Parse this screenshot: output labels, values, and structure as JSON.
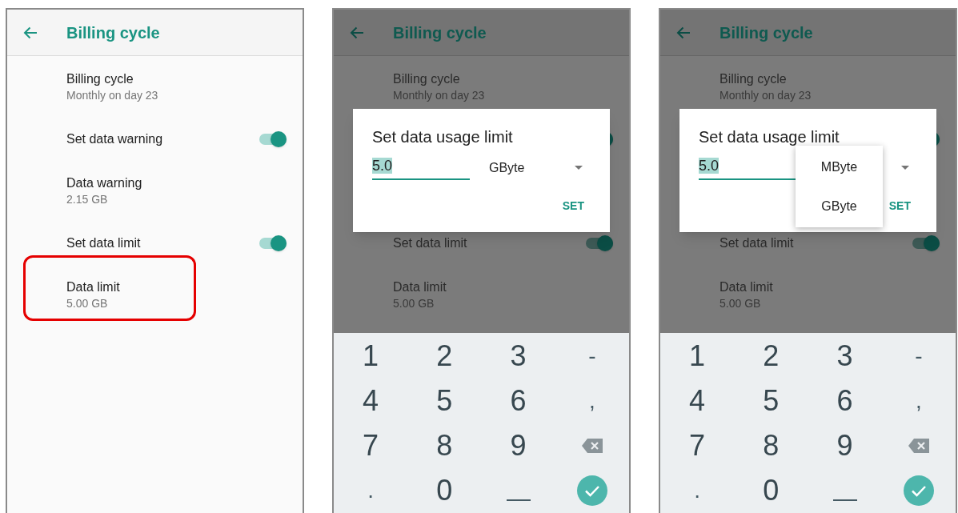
{
  "screens": [
    {
      "header": {
        "title": "Billing cycle"
      },
      "items": [
        {
          "kind": "text",
          "title": "Billing cycle",
          "summary": "Monthly on day 23",
          "highlighted": false
        },
        {
          "kind": "toggle",
          "title": "Set data warning",
          "on": true,
          "highlighted": false
        },
        {
          "kind": "text",
          "title": "Data warning",
          "summary": "2.15 GB",
          "highlighted": false
        },
        {
          "kind": "toggle",
          "title": "Set data limit",
          "on": true,
          "highlighted": false
        },
        {
          "kind": "text",
          "title": "Data limit",
          "summary": "5.00 GB",
          "highlighted": true
        }
      ]
    },
    {
      "header": {
        "title": "Billing cycle"
      },
      "items": [
        {
          "kind": "text",
          "title": "Billing cycle",
          "summary": "Monthly on day 23",
          "highlighted": false
        },
        {
          "kind": "toggle",
          "on": true
        },
        {
          "kind": "blank"
        },
        {
          "kind": "toggle",
          "title": "Set data limit",
          "on": true,
          "highlighted": false
        },
        {
          "kind": "text",
          "title": "Data limit",
          "summary": "5.00 GB",
          "highlighted": false
        }
      ],
      "dialog": {
        "title": "Set data usage limit",
        "value": "5.0",
        "unit": "GByte",
        "button": "SET"
      },
      "keyboard": [
        {
          "kind": "char",
          "label": "1"
        },
        {
          "kind": "char",
          "label": "2"
        },
        {
          "kind": "char",
          "label": "3"
        },
        {
          "kind": "symbol",
          "label": "-"
        },
        {
          "kind": "char",
          "label": "4"
        },
        {
          "kind": "char",
          "label": "5"
        },
        {
          "kind": "char",
          "label": "6"
        },
        {
          "kind": "symbol",
          "label": ","
        },
        {
          "kind": "char",
          "label": "7"
        },
        {
          "kind": "char",
          "label": "8"
        },
        {
          "kind": "char",
          "label": "9"
        },
        {
          "kind": "backspace"
        },
        {
          "kind": "symbol",
          "label": "."
        },
        {
          "kind": "char",
          "label": "0"
        },
        {
          "kind": "space"
        },
        {
          "kind": "done"
        }
      ]
    },
    {
      "header": {
        "title": "Billing cycle"
      },
      "items": [
        {
          "kind": "text",
          "title": "Billing cycle",
          "summary": "Monthly on day 23",
          "highlighted": false
        },
        {
          "kind": "toggle",
          "on": true
        },
        {
          "kind": "blank"
        },
        {
          "kind": "toggle",
          "title": "Set data limit",
          "on": true,
          "highlighted": false
        },
        {
          "kind": "text",
          "title": "Data limit",
          "summary": "5.00 GB",
          "highlighted": false
        }
      ],
      "dialog": {
        "title": "Set data usage limit",
        "value": "5.0",
        "menu": [
          "MByte",
          "GByte"
        ],
        "button": "SET"
      },
      "keyboard": [
        {
          "kind": "char",
          "label": "1"
        },
        {
          "kind": "char",
          "label": "2"
        },
        {
          "kind": "char",
          "label": "3"
        },
        {
          "kind": "symbol",
          "label": "-"
        },
        {
          "kind": "char",
          "label": "4"
        },
        {
          "kind": "char",
          "label": "5"
        },
        {
          "kind": "char",
          "label": "6"
        },
        {
          "kind": "symbol",
          "label": ","
        },
        {
          "kind": "char",
          "label": "7"
        },
        {
          "kind": "char",
          "label": "8"
        },
        {
          "kind": "char",
          "label": "9"
        },
        {
          "kind": "backspace"
        },
        {
          "kind": "symbol",
          "label": "."
        },
        {
          "kind": "char",
          "label": "0"
        },
        {
          "kind": "space"
        },
        {
          "kind": "done"
        }
      ]
    }
  ]
}
